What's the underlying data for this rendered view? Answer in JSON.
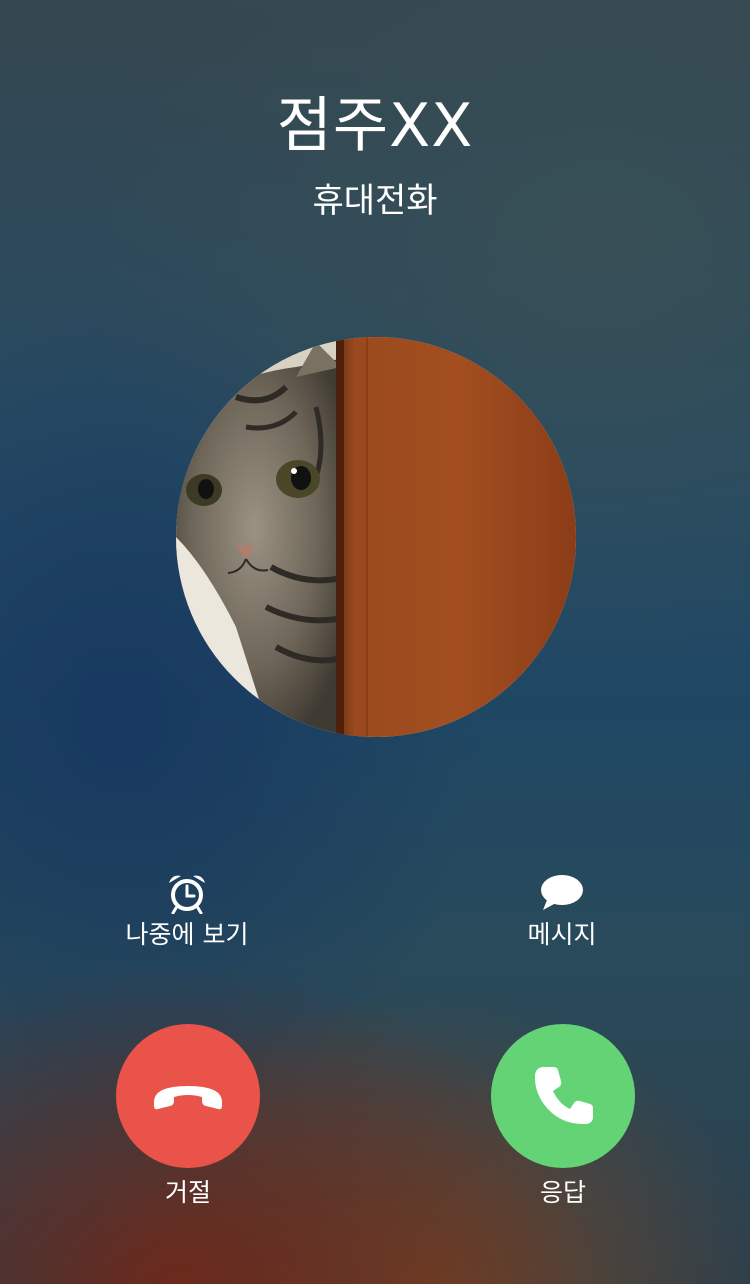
{
  "call": {
    "caller_name": "점주XX",
    "caller_type": "휴대전화"
  },
  "actions": {
    "remind_label": "나중에 보기",
    "message_label": "메시지",
    "decline_label": "거절",
    "accept_label": "응답"
  },
  "icons": {
    "remind": "alarm-clock-icon",
    "message": "speech-bubble-icon",
    "decline": "phone-hangup-icon",
    "accept": "phone-icon"
  },
  "colors": {
    "decline": "#e9534a",
    "accept": "#64d376",
    "text": "#ffffff"
  }
}
